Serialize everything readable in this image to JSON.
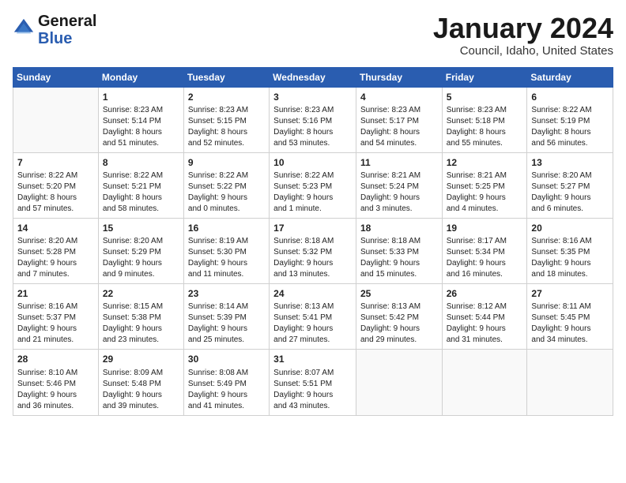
{
  "header": {
    "logo_line1": "General",
    "logo_line2": "Blue",
    "month_title": "January 2024",
    "subtitle": "Council, Idaho, United States"
  },
  "columns": [
    "Sunday",
    "Monday",
    "Tuesday",
    "Wednesday",
    "Thursday",
    "Friday",
    "Saturday"
  ],
  "weeks": [
    [
      {
        "day": "",
        "content": ""
      },
      {
        "day": "1",
        "content": "Sunrise: 8:23 AM\nSunset: 5:14 PM\nDaylight: 8 hours\nand 51 minutes."
      },
      {
        "day": "2",
        "content": "Sunrise: 8:23 AM\nSunset: 5:15 PM\nDaylight: 8 hours\nand 52 minutes."
      },
      {
        "day": "3",
        "content": "Sunrise: 8:23 AM\nSunset: 5:16 PM\nDaylight: 8 hours\nand 53 minutes."
      },
      {
        "day": "4",
        "content": "Sunrise: 8:23 AM\nSunset: 5:17 PM\nDaylight: 8 hours\nand 54 minutes."
      },
      {
        "day": "5",
        "content": "Sunrise: 8:23 AM\nSunset: 5:18 PM\nDaylight: 8 hours\nand 55 minutes."
      },
      {
        "day": "6",
        "content": "Sunrise: 8:22 AM\nSunset: 5:19 PM\nDaylight: 8 hours\nand 56 minutes."
      }
    ],
    [
      {
        "day": "7",
        "content": "Sunrise: 8:22 AM\nSunset: 5:20 PM\nDaylight: 8 hours\nand 57 minutes."
      },
      {
        "day": "8",
        "content": "Sunrise: 8:22 AM\nSunset: 5:21 PM\nDaylight: 8 hours\nand 58 minutes."
      },
      {
        "day": "9",
        "content": "Sunrise: 8:22 AM\nSunset: 5:22 PM\nDaylight: 9 hours\nand 0 minutes."
      },
      {
        "day": "10",
        "content": "Sunrise: 8:22 AM\nSunset: 5:23 PM\nDaylight: 9 hours\nand 1 minute."
      },
      {
        "day": "11",
        "content": "Sunrise: 8:21 AM\nSunset: 5:24 PM\nDaylight: 9 hours\nand 3 minutes."
      },
      {
        "day": "12",
        "content": "Sunrise: 8:21 AM\nSunset: 5:25 PM\nDaylight: 9 hours\nand 4 minutes."
      },
      {
        "day": "13",
        "content": "Sunrise: 8:20 AM\nSunset: 5:27 PM\nDaylight: 9 hours\nand 6 minutes."
      }
    ],
    [
      {
        "day": "14",
        "content": "Sunrise: 8:20 AM\nSunset: 5:28 PM\nDaylight: 9 hours\nand 7 minutes."
      },
      {
        "day": "15",
        "content": "Sunrise: 8:20 AM\nSunset: 5:29 PM\nDaylight: 9 hours\nand 9 minutes."
      },
      {
        "day": "16",
        "content": "Sunrise: 8:19 AM\nSunset: 5:30 PM\nDaylight: 9 hours\nand 11 minutes."
      },
      {
        "day": "17",
        "content": "Sunrise: 8:18 AM\nSunset: 5:32 PM\nDaylight: 9 hours\nand 13 minutes."
      },
      {
        "day": "18",
        "content": "Sunrise: 8:18 AM\nSunset: 5:33 PM\nDaylight: 9 hours\nand 15 minutes."
      },
      {
        "day": "19",
        "content": "Sunrise: 8:17 AM\nSunset: 5:34 PM\nDaylight: 9 hours\nand 16 minutes."
      },
      {
        "day": "20",
        "content": "Sunrise: 8:16 AM\nSunset: 5:35 PM\nDaylight: 9 hours\nand 18 minutes."
      }
    ],
    [
      {
        "day": "21",
        "content": "Sunrise: 8:16 AM\nSunset: 5:37 PM\nDaylight: 9 hours\nand 21 minutes."
      },
      {
        "day": "22",
        "content": "Sunrise: 8:15 AM\nSunset: 5:38 PM\nDaylight: 9 hours\nand 23 minutes."
      },
      {
        "day": "23",
        "content": "Sunrise: 8:14 AM\nSunset: 5:39 PM\nDaylight: 9 hours\nand 25 minutes."
      },
      {
        "day": "24",
        "content": "Sunrise: 8:13 AM\nSunset: 5:41 PM\nDaylight: 9 hours\nand 27 minutes."
      },
      {
        "day": "25",
        "content": "Sunrise: 8:13 AM\nSunset: 5:42 PM\nDaylight: 9 hours\nand 29 minutes."
      },
      {
        "day": "26",
        "content": "Sunrise: 8:12 AM\nSunset: 5:44 PM\nDaylight: 9 hours\nand 31 minutes."
      },
      {
        "day": "27",
        "content": "Sunrise: 8:11 AM\nSunset: 5:45 PM\nDaylight: 9 hours\nand 34 minutes."
      }
    ],
    [
      {
        "day": "28",
        "content": "Sunrise: 8:10 AM\nSunset: 5:46 PM\nDaylight: 9 hours\nand 36 minutes."
      },
      {
        "day": "29",
        "content": "Sunrise: 8:09 AM\nSunset: 5:48 PM\nDaylight: 9 hours\nand 39 minutes."
      },
      {
        "day": "30",
        "content": "Sunrise: 8:08 AM\nSunset: 5:49 PM\nDaylight: 9 hours\nand 41 minutes."
      },
      {
        "day": "31",
        "content": "Sunrise: 8:07 AM\nSunset: 5:51 PM\nDaylight: 9 hours\nand 43 minutes."
      },
      {
        "day": "",
        "content": ""
      },
      {
        "day": "",
        "content": ""
      },
      {
        "day": "",
        "content": ""
      }
    ]
  ]
}
